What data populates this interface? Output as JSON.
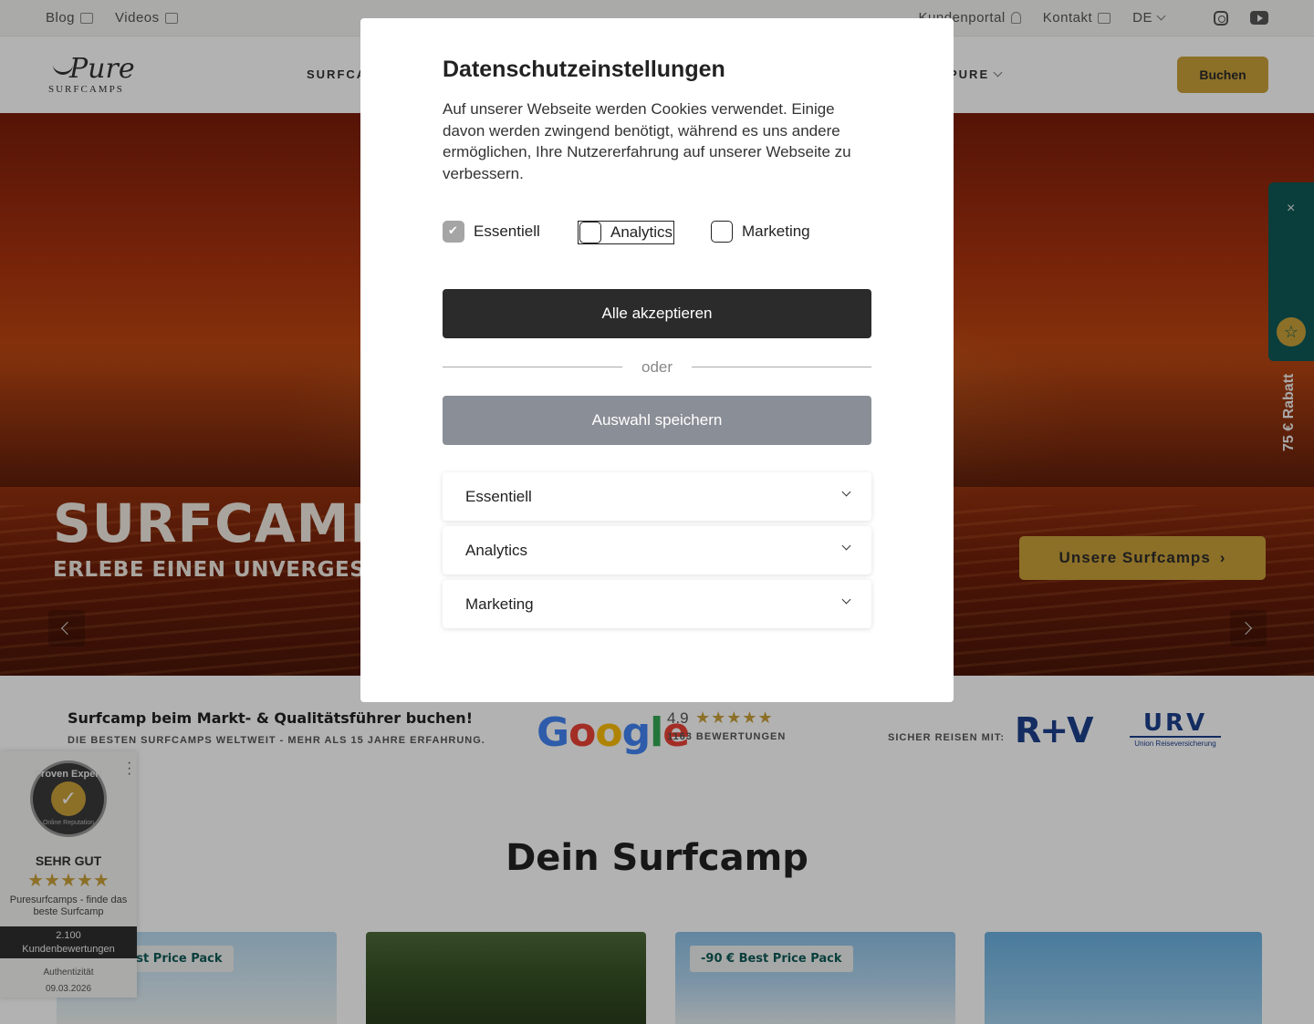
{
  "topbar": {
    "left": [
      {
        "label": "Blog",
        "icon": "newspaper-icon"
      },
      {
        "label": "Videos",
        "icon": "video-icon"
      }
    ],
    "right": [
      {
        "label": "Kundenportal",
        "icon": "user-icon"
      },
      {
        "label": "Kontakt",
        "icon": "mail-icon"
      }
    ],
    "language": "DE",
    "social": [
      "instagram-icon",
      "youtube-icon"
    ]
  },
  "nav": {
    "logo_script": "Pure",
    "logo_sub": "SURFCAMPS",
    "menu_left": "SURFCA",
    "menu_right": "PURE",
    "book_button": "Buchen"
  },
  "hero": {
    "title": "SURFCAMP E",
    "subtitle": "ERLEBE EINEN UNVERGESSLIC",
    "cta": "Unsere Surfcamps",
    "discount": "75 € Rabatt",
    "discount_close": "×"
  },
  "trust": {
    "headline": "Surfcamp beim Markt- & Qualitätsführer buchen!",
    "subline": "DIE BESTEN SURFCAMPS WELTWEIT - MEHR ALS 15 JAHRE ERFAHRUNG.",
    "google_letters": [
      "G",
      "o",
      "o",
      "g",
      "l",
      "e"
    ],
    "google_colors": [
      "#4285F4",
      "#EA4335",
      "#FBBC05",
      "#4285F4",
      "#34A853",
      "#EA4335"
    ],
    "rating": "4.9",
    "stars": "★★★★★",
    "reviews": "1163 BEWERTUNGEN",
    "secure_label": "SICHER REISEN MIT:",
    "partner1": "R+V",
    "partner2": "URV",
    "partner2_sub": "Union Reiseversicherung"
  },
  "section": {
    "title": "Dein Surfcamp",
    "badges": [
      "-90 € Best Price Pack",
      "-90 € Best Price Pack"
    ]
  },
  "proven_expert": {
    "seal_top": "Proven Expert",
    "seal_bottom": "Online Reputation",
    "grade": "SEHR GUT",
    "stars": "★★★★★",
    "description": "Puresurfcamps - finde das beste Surfcamp",
    "count": "2.100",
    "count_label": "Kundenbewertungen",
    "auth_label": "Authentizität",
    "auth_date": "09.03.2026"
  },
  "modal": {
    "title": "Datenschutzeinstellungen",
    "text": "Auf unserer Webseite werden Cookies verwendet. Einige davon werden zwingend benötigt, während es uns andere ermöglichen, Ihre Nutzererfahrung auf unserer Webseite zu verbessern.",
    "checkboxes": [
      {
        "label": "Essentiell",
        "checked": true
      },
      {
        "label": "Analytics",
        "checked": false
      },
      {
        "label": "Marketing",
        "checked": false
      }
    ],
    "accept_all": "Alle akzeptieren",
    "or": "oder",
    "save": "Auswahl speichern",
    "accordions": [
      "Essentiell",
      "Analytics",
      "Marketing"
    ]
  }
}
